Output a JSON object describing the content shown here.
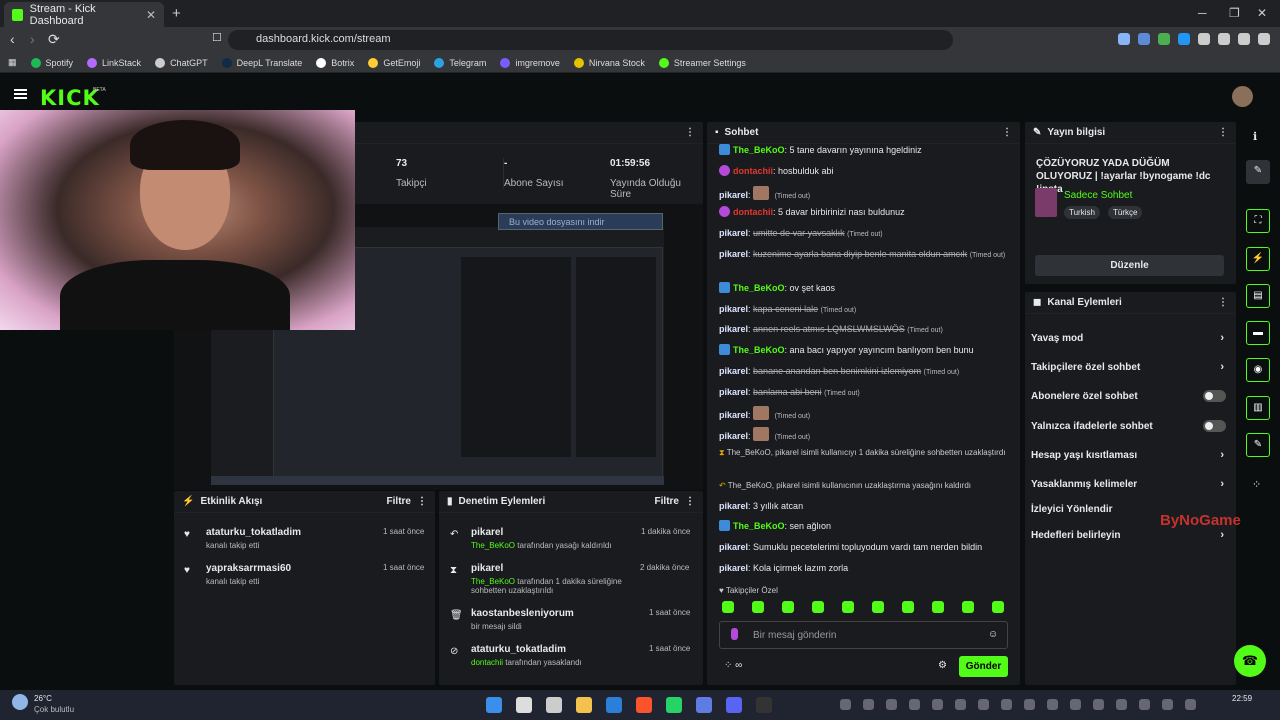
{
  "browser": {
    "tab_title": "Stream - Kick Dashboard",
    "url": "dashboard.kick.com/stream",
    "bookmarks": [
      "Spotify",
      "LinkStack",
      "ChatGPT",
      "DeepL Translate",
      "Botrix",
      "GetEmoji",
      "Telegram",
      "imgremove",
      "Nirvana Stock",
      "Streamer Settings"
    ]
  },
  "header": {
    "logo": "KICK",
    "beta": "BETA"
  },
  "stats": [
    {
      "value": "73",
      "label": "Takipçi"
    },
    {
      "value": "-",
      "label": "Abone Sayısı"
    },
    {
      "value": "01:59:56",
      "label": "Yayında Olduğu Süre"
    }
  ],
  "video": {
    "download_label": "Bu video dosyasını indir"
  },
  "activity": {
    "title": "Etkinlik Akışı",
    "filter": "Filtre",
    "items": [
      {
        "user": "ataturku_tokatladim",
        "action": "kanalı takip etti",
        "time": "1 saat önce"
      },
      {
        "user": "yapraksarrmasi60",
        "action": "kanalı takip etti",
        "time": "1 saat önce"
      }
    ]
  },
  "moderation": {
    "title": "Denetim Eylemleri",
    "filter": "Filtre",
    "items": [
      {
        "user": "pikarel",
        "by": "The_BeKoO",
        "action": "tarafından yasağı kaldırıldı",
        "time": "1 dakika önce"
      },
      {
        "user": "pikarel",
        "by": "The_BeKoO",
        "action": "tarafından 1 dakika süreliğine sohbetten uzaklaştırıldı",
        "time": "2 dakika önce"
      },
      {
        "user": "kaostanbesleniyorum",
        "by": "",
        "action": "bir mesajı sildi",
        "time": "1 saat önce"
      },
      {
        "user": "ataturku_tokatladim",
        "by": "dontachii",
        "action": "tarafından yasaklandı",
        "time": "1 saat önce"
      }
    ]
  },
  "chat": {
    "title": "Sohbet",
    "messages": [
      {
        "user": "The_BeKoO",
        "text": "5 tane davarın yayınına hgeldiniz"
      },
      {
        "user": "dontachii",
        "text": "hosbulduk abi"
      },
      {
        "user": "pikarel",
        "text": "",
        "note": "(Timed out)"
      },
      {
        "user": "dontachii",
        "text": "5 davar birbirinizi nası buldunuz"
      },
      {
        "user": "pikarel",
        "text": "umitte de var yavsaklık",
        "note": "(Timed out)"
      },
      {
        "user": "pikarel",
        "text": "kuzenime ayarla bana diyip benle manita oldun amcık",
        "note": "(Timed out)"
      },
      {
        "user": "The_BeKoO",
        "text": "ov şet kaos"
      },
      {
        "user": "pikarel",
        "text": "kapa ceneni lale",
        "note": "(Timed out)"
      },
      {
        "user": "pikarel",
        "text": "annen reels atmıs LQMSLWMSLWÖS",
        "note": "(Timed out)"
      },
      {
        "user": "The_BeKoO",
        "text": "ana bacı yapıyor yayıncım banlıyom ben bunu"
      },
      {
        "user": "pikarel",
        "text": "banane anandan ben benimkini izlemiyom",
        "note": "(Timed out)"
      },
      {
        "user": "pikarel",
        "text": "banlama abi beni",
        "note": "(Timed out)"
      },
      {
        "user": "pikarel",
        "text": "",
        "note": "(Timed out)"
      },
      {
        "user": "pikarel",
        "text": "",
        "note": "(Timed out)"
      },
      {
        "user": "",
        "text": "The_BeKoO, pikarel isimli kullanıcıyı 1 dakika süreliğine sohbetten uzaklaştırdı"
      },
      {
        "user": "",
        "text": "The_BeKoO, pikarel isimli kullanıcının uzaklaştırma yasağını kaldırdı"
      },
      {
        "user": "pikarel",
        "text": "3 yıllık atcan"
      },
      {
        "user": "The_BeKoO",
        "text": "sen ağlıon"
      },
      {
        "user": "pikarel",
        "text": "Sumuklu pecetelerimi topluyodum vardı tam nerden bildin"
      },
      {
        "user": "pikarel",
        "text": "Kola içirmek lazım zorla"
      }
    ],
    "followers_only": "Takipçiler Özel",
    "placeholder": "Bir mesaj gönderin",
    "send": "Gönder"
  },
  "stream_info": {
    "title": "Yayın bilgisi",
    "stream_title": "ÇÖZÜYORUZ YADA DÜĞÜM OLUYORUZ | !ayarlar !bynogame !dc !insta",
    "category": "Sadece Sohbet",
    "tags": [
      "Turkish",
      "Türkçe"
    ],
    "edit": "Düzenle"
  },
  "channel_actions": {
    "title": "Kanal Eylemleri",
    "items": [
      "Yavaş mod",
      "Takipçilere özel sohbet",
      "Abonelere özel sohbet",
      "Yalnızca ifadelerle sohbet",
      "Hesap yaşı kısıtlaması",
      "Yasaklanmış kelimeler",
      "İzleyici Yönlendir",
      "Hedefleri belirleyin"
    ]
  },
  "overlay": {
    "watermark": "ByNoGame"
  },
  "taskbar": {
    "temp": "26°C",
    "weather": "Çok bulutlu",
    "time": "22:59"
  }
}
